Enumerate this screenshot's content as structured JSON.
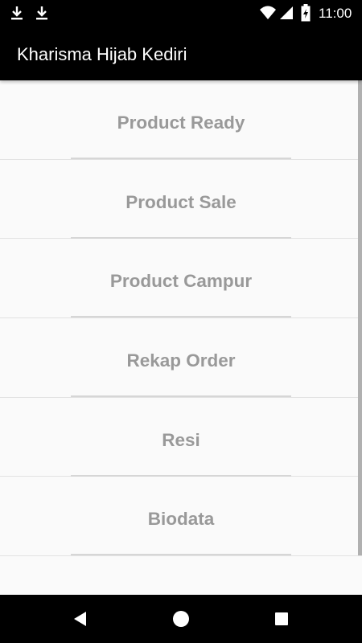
{
  "status_bar": {
    "time": "11:00",
    "icons": [
      "download-icon",
      "download-icon",
      "wifi-icon",
      "signal-icon",
      "battery-charging-icon"
    ]
  },
  "app_bar": {
    "title": "Kharisma Hijab Kediri"
  },
  "menu": {
    "items": [
      {
        "label": "Product Ready"
      },
      {
        "label": "Product Sale"
      },
      {
        "label": "Product Campur"
      },
      {
        "label": "Rekap Order"
      },
      {
        "label": "Resi"
      },
      {
        "label": "Biodata"
      }
    ]
  },
  "nav_bar": {
    "icons": [
      "back-icon",
      "home-icon",
      "recents-icon"
    ]
  },
  "colors": {
    "app_bar": "#000000",
    "list_background": "#fafafa",
    "label_text": "#999999",
    "divider": "#e2e2e2"
  }
}
